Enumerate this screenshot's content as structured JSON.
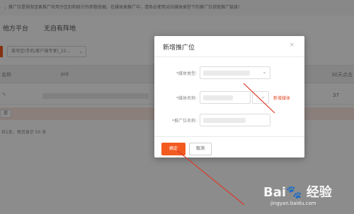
{
  "background": {
    "notice": "，推广位是指淘宝客推广时用于区别和统计的参数依据，在媒体类推广中，请务必使用对应媒体类型下的推广位获取推广链接！",
    "tabs": [
      "他方平台",
      "无自有阵地"
    ],
    "filter_select": "爱淘宝(手机/客户端专享)_22...",
    "table_headers": {
      "col1": "名称",
      "col2": "pid",
      "col3": "30天点击"
    },
    "row_value": "37",
    "highlight_btn": "提",
    "pager": "共1条，每页显示 50 条"
  },
  "modal": {
    "title": "新增推广位",
    "close_glyph": "×",
    "fields": {
      "media_type_label": "*媒体类型:",
      "media_name_label": "*媒体名称:",
      "slot_name_label": "*推广位名称:"
    },
    "new_media_link": "新增媒体",
    "confirm_label": "确定",
    "cancel_label": "取消"
  },
  "watermark": {
    "url": "jingyan.baidu.com"
  },
  "colors": {
    "accent": "#f25a20",
    "annotation": "#d93b2b"
  }
}
